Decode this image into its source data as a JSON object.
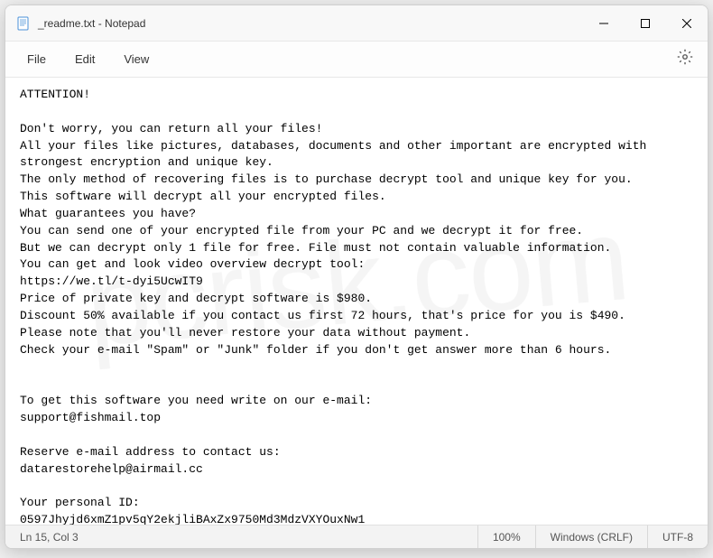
{
  "titlebar": {
    "title": "_readme.txt - Notepad"
  },
  "menu": {
    "file": "File",
    "edit": "Edit",
    "view": "View"
  },
  "body": {
    "text": "ATTENTION!\n\nDon't worry, you can return all your files!\nAll your files like pictures, databases, documents and other important are encrypted with strongest encryption and unique key.\nThe only method of recovering files is to purchase decrypt tool and unique key for you.\nThis software will decrypt all your encrypted files.\nWhat guarantees you have?\nYou can send one of your encrypted file from your PC and we decrypt it for free.\nBut we can decrypt only 1 file for free. File must not contain valuable information.\nYou can get and look video overview decrypt tool:\nhttps://we.tl/t-dyi5UcwIT9\nPrice of private key and decrypt software is $980.\nDiscount 50% available if you contact us first 72 hours, that's price for you is $490.\nPlease note that you'll never restore your data without payment.\nCheck your e-mail \"Spam\" or \"Junk\" folder if you don't get answer more than 6 hours.\n\n\nTo get this software you need write on our e-mail:\nsupport@fishmail.top\n\nReserve e-mail address to contact us:\ndatarestorehelp@airmail.cc\n\nYour personal ID:\n0597Jhyjd6xmZ1pv5qY2ekjliBAxZx9750Md3MdzVXYOuxNw1"
  },
  "status": {
    "position": "Ln 15, Col 3",
    "zoom": "100%",
    "lineending": "Windows (CRLF)",
    "encoding": "UTF-8"
  },
  "watermark": "pcrisk.com"
}
